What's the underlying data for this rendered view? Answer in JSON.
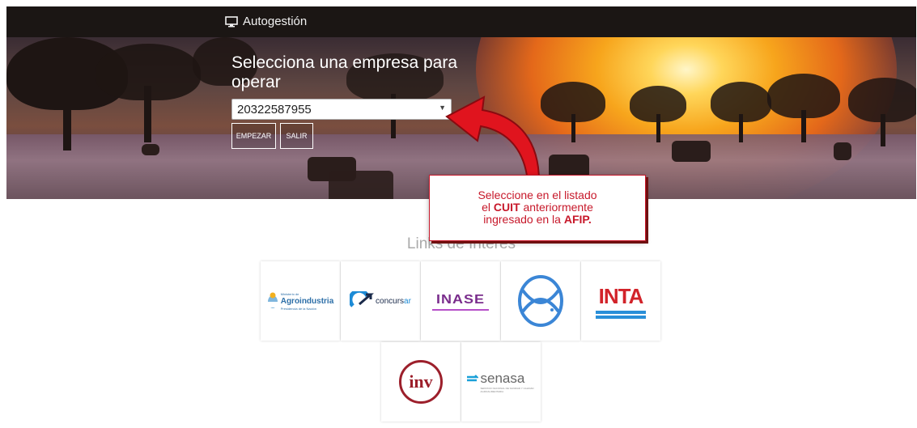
{
  "header": {
    "brand_label": "Autogestión"
  },
  "hero": {
    "title": "Selecciona una empresa para operar",
    "company_select": {
      "selected_value": "20322587955"
    },
    "start_button_label": "EMPEZAR",
    "exit_button_label": "SALIR"
  },
  "callout": {
    "line1": "Seleccione en el listado",
    "line2_pre": "el ",
    "line2_bold": "CUIT",
    "line2_post": " anteriormente",
    "line3_pre": "ingresado en la ",
    "line3_bold": "AFIP."
  },
  "links": {
    "title": "Links de Interes",
    "agroindustria": {
      "small": "Ministerio de",
      "main": "Agroindustria",
      "sub": "Presidencia de la Nación"
    },
    "concursar": {
      "main": "concurs",
      "accent": "ar"
    },
    "inase": {
      "main": "INASE"
    },
    "fish": {},
    "inta": {
      "main": "INTA"
    },
    "inv": {
      "main": "inv"
    },
    "senasa": {
      "main": "senasa",
      "sub": "SERVICIO NACIONAL DE SANIDAD Y CALIDAD AGROALIMENTARIA"
    }
  },
  "colors": {
    "accent_red": "#c7182a",
    "topbar": "#1b1614"
  }
}
